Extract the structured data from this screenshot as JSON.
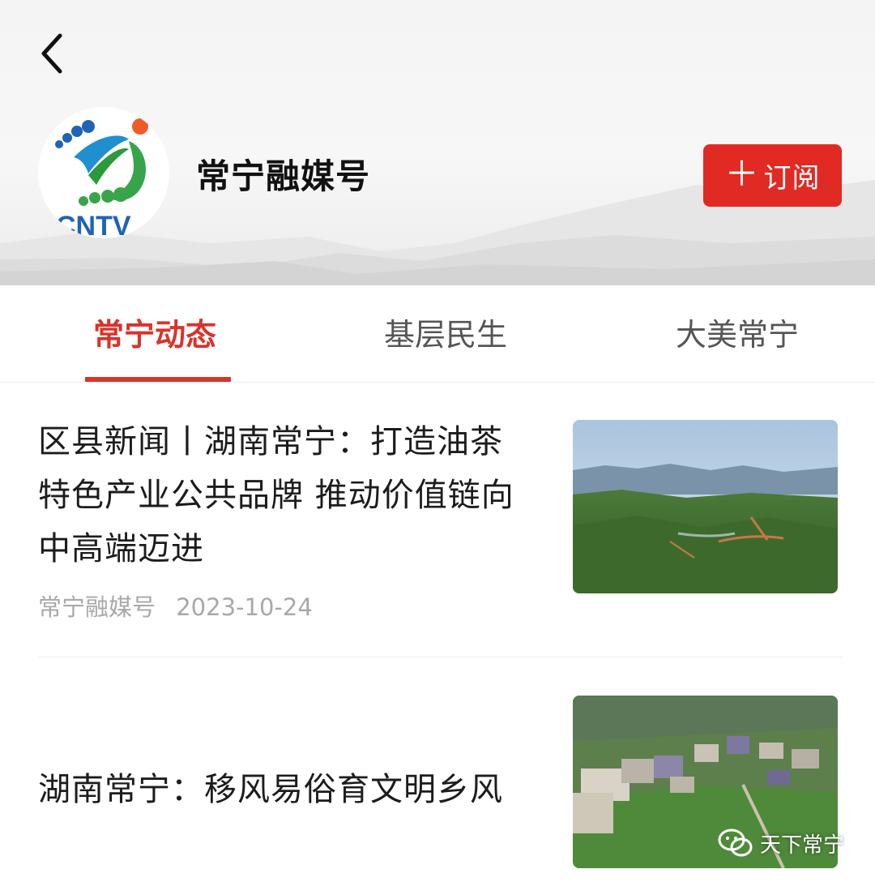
{
  "header": {
    "channel_name": "常宁融媒号",
    "avatar_text": "CNTV",
    "subscribe": {
      "plus": "＋",
      "label": "订阅"
    }
  },
  "tabs": [
    {
      "label": "常宁动态",
      "active": true
    },
    {
      "label": "基层民生",
      "active": false
    },
    {
      "label": "大美常宁",
      "active": false
    }
  ],
  "articles": [
    {
      "title_lines": [
        "区县新闻丨湖南常宁：打造油茶",
        "特色产业公共品牌 推动价值链向",
        "中高端迈进"
      ],
      "source": "常宁融媒号",
      "date": "2023-10-24"
    },
    {
      "title_lines": [
        "湖南常宁：移风易俗育文明乡风"
      ]
    }
  ],
  "watermark": {
    "text": "天下常宁"
  },
  "colors": {
    "accent": "#d8342b",
    "subscribe_bg": "#e02a23"
  }
}
